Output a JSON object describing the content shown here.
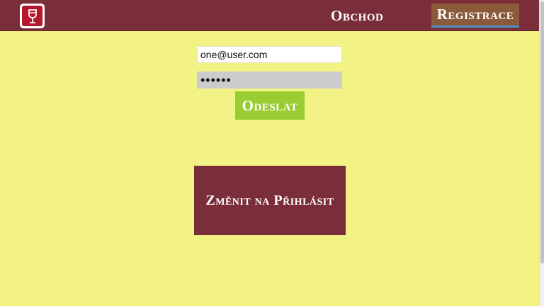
{
  "navbar": {
    "logo_icon": "wine-glass-icon",
    "shop_label": "Obchod",
    "register_label": "Registrace"
  },
  "form": {
    "email_value": "one@user.com",
    "password_value": "••••••",
    "submit_label": "Odeslat"
  },
  "switch_label": "Změnit na Přihlásit",
  "colors": {
    "background": "#f2f285",
    "navbar": "#7a2e3a",
    "logo_red": "#b5172d",
    "register_bg": "#8b5a3a",
    "register_underline": "#4e8fc2",
    "submit_green": "#9acd32"
  }
}
